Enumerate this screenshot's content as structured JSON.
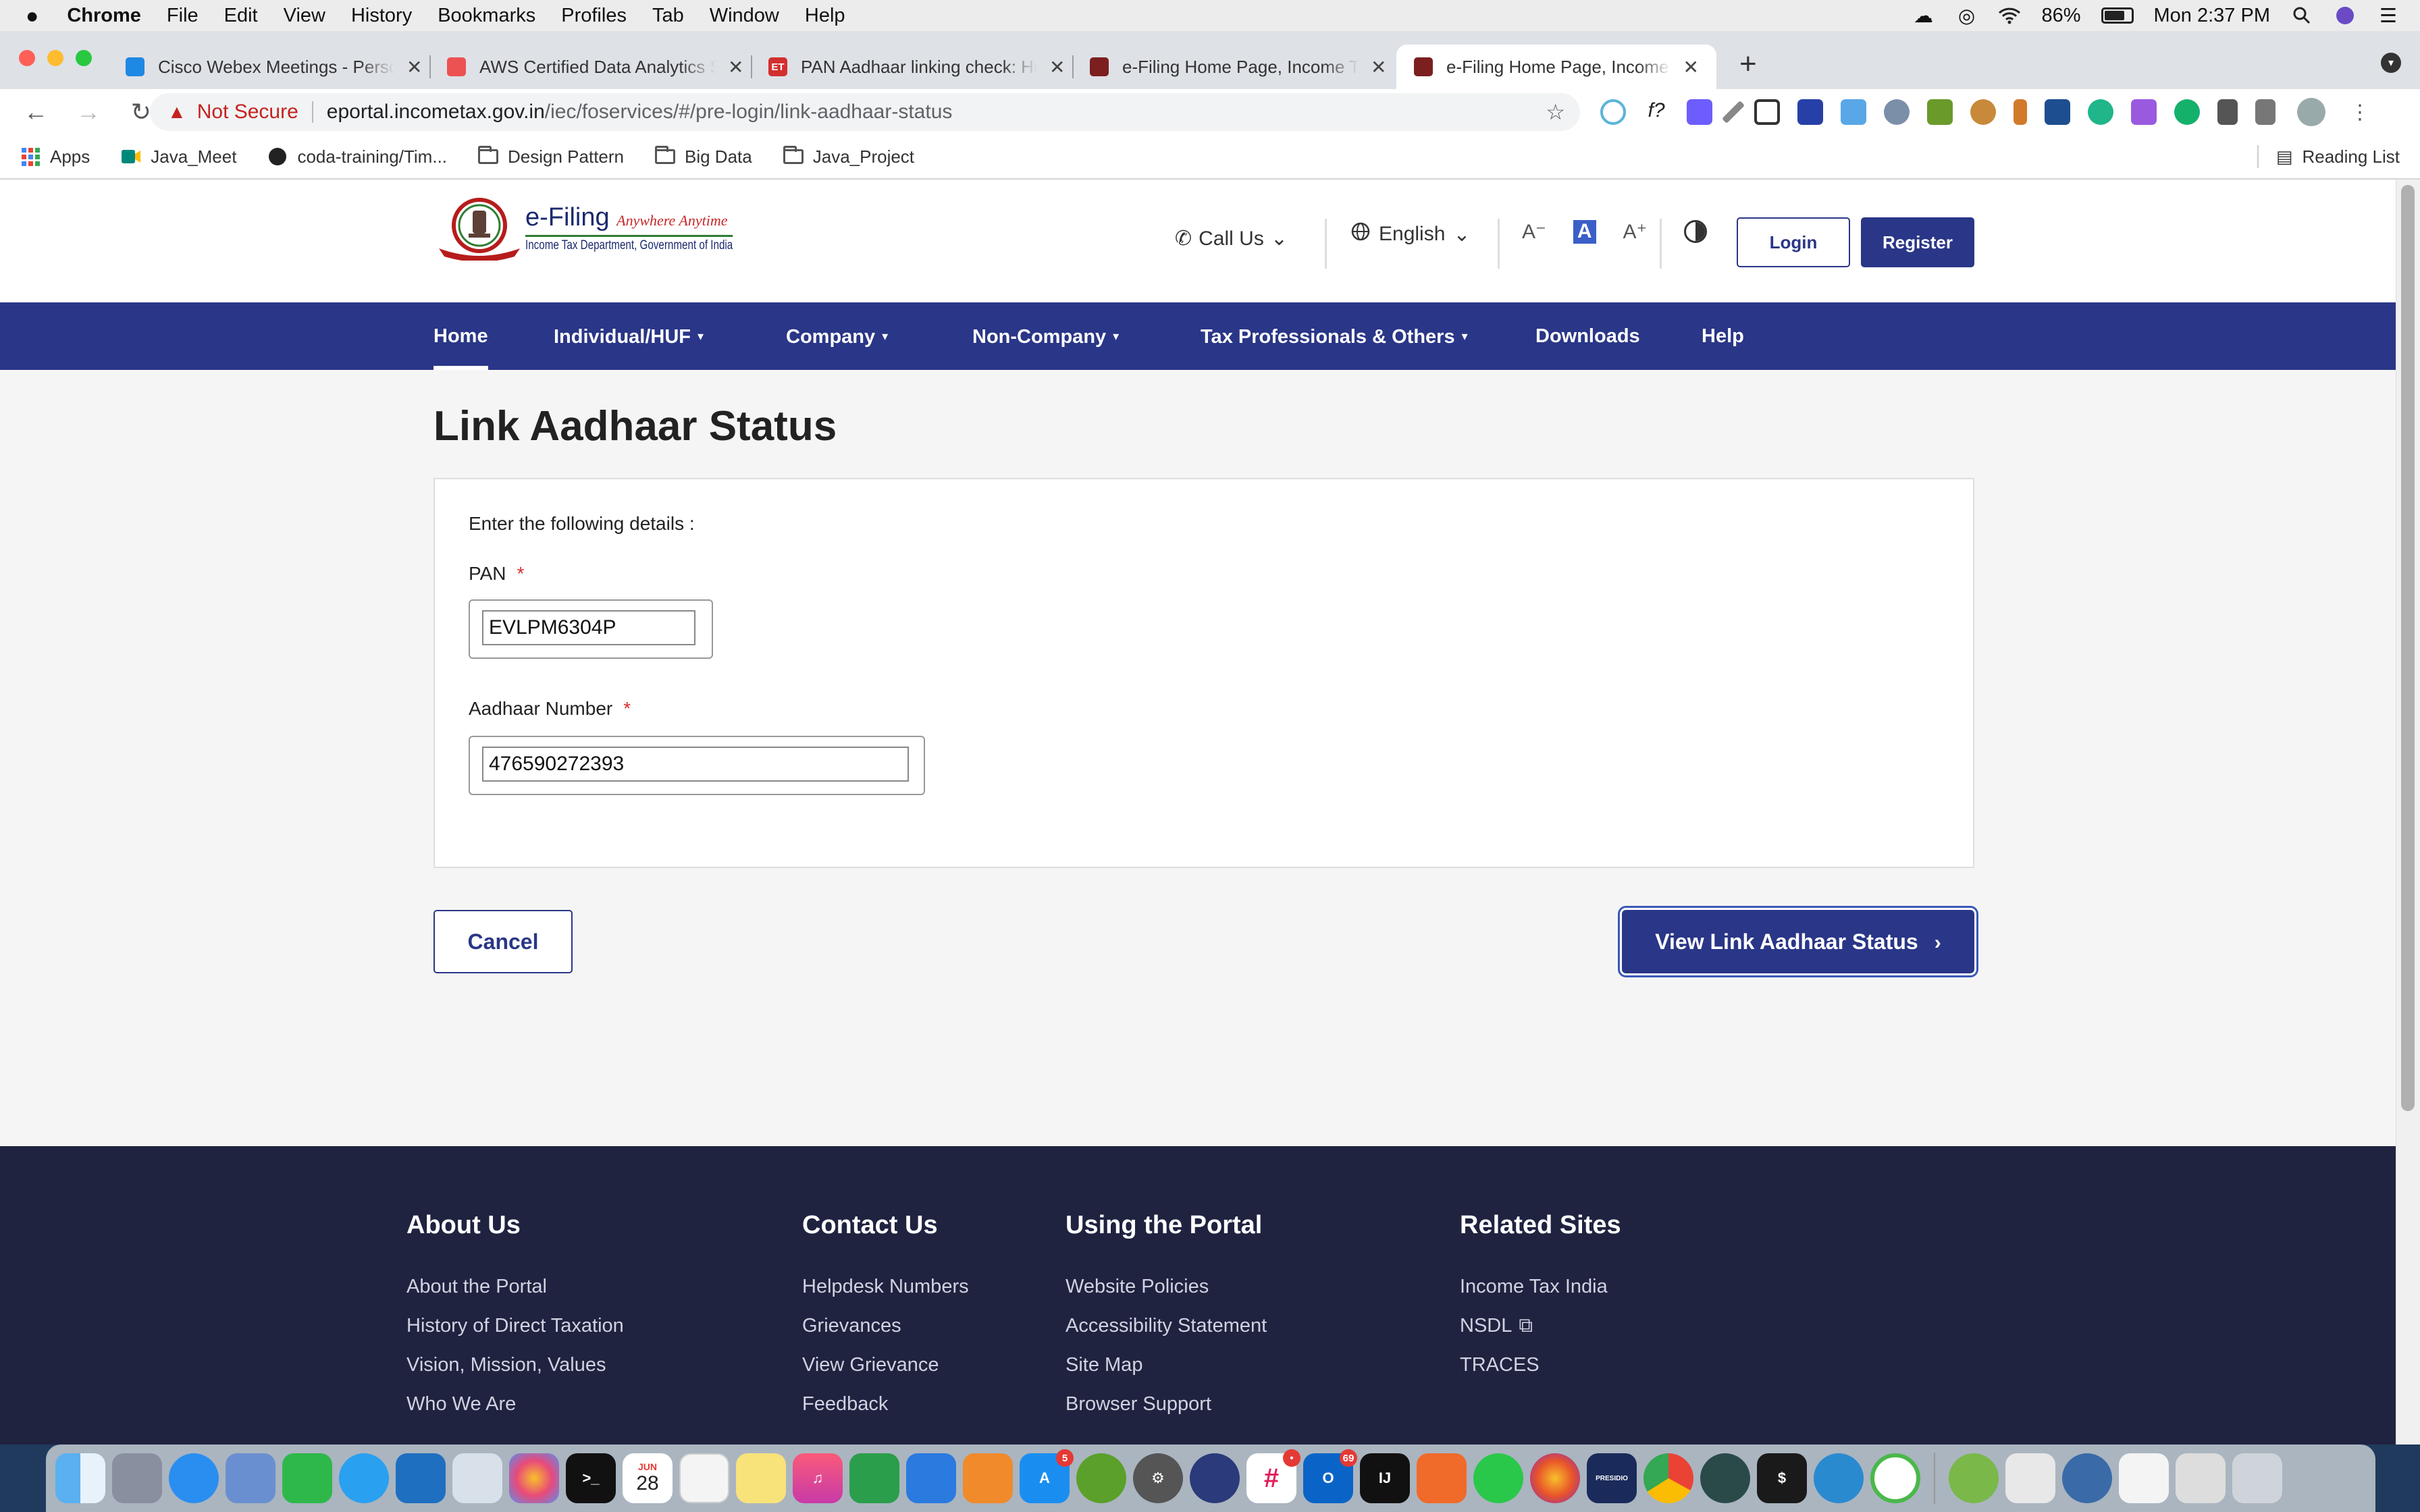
{
  "menubar": {
    "app": "Chrome",
    "items": [
      "File",
      "Edit",
      "View",
      "History",
      "Bookmarks",
      "Profiles",
      "Tab",
      "Window",
      "Help"
    ],
    "battery": "86%",
    "clock": "Mon 2:37 PM"
  },
  "tabs": [
    {
      "title": "Cisco Webex Meetings - Personal Room",
      "favicon_color": "#1e88e5"
    },
    {
      "title": "AWS Certified Data Analytics Specialty",
      "favicon_color": "#ec5252"
    },
    {
      "title": "PAN Aadhaar linking check: How to",
      "favicon_color": "#d32f2f"
    },
    {
      "title": "e-Filing Home Page, Income Tax Department",
      "favicon_color": "#7b1f1f"
    },
    {
      "title": "e-Filing Home Page, Income Tax Department",
      "favicon_color": "#7b1f1f"
    }
  ],
  "address": {
    "security": "Not Secure",
    "host": "eportal.incometax.gov.in",
    "path": "/iec/foservices/#/pre-login/link-aadhaar-status"
  },
  "bookmarks": {
    "items": [
      "Apps",
      "Java_Meet",
      "coda-training/Tim...",
      "Design Pattern",
      "Big Data",
      "Java_Project"
    ],
    "reading_list": "Reading List"
  },
  "site": {
    "logo": {
      "title": "e-Filing",
      "tagline": "Anywhere Anytime",
      "dept": "Income Tax Department, Government of India"
    },
    "call_us": "Call Us",
    "language": "English",
    "font_controls": [
      "A⁻",
      "A",
      "A⁺"
    ],
    "login": "Login",
    "register": "Register",
    "nav": [
      "Home",
      "Individual/HUF",
      "Company",
      "Non-Company",
      "Tax Professionals & Others",
      "Downloads",
      "Help"
    ]
  },
  "form": {
    "title": "Link Aadhaar Status",
    "instruction": "Enter the following details :",
    "pan_label": "PAN",
    "pan_value": "EVLPM6304P",
    "aadhaar_label": "Aadhaar Number",
    "aadhaar_value": "476590272393",
    "required_mark": "*",
    "cancel": "Cancel",
    "submit": "View Link Aadhaar Status"
  },
  "footer": {
    "columns": [
      {
        "heading": "About Us",
        "links": [
          "About the Portal",
          "History of Direct Taxation",
          "Vision, Mission, Values",
          "Who We Are"
        ]
      },
      {
        "heading": "Contact Us",
        "links": [
          "Helpdesk Numbers",
          "Grievances",
          "View Grievance",
          "Feedback"
        ]
      },
      {
        "heading": "Using the Portal",
        "links": [
          "Website Policies",
          "Accessibility Statement",
          "Site Map",
          "Browser Support"
        ]
      },
      {
        "heading": "Related Sites",
        "links": [
          "Income Tax India",
          "NSDL",
          "TRACES"
        ]
      }
    ]
  },
  "dock": {
    "badges": {
      "appstore": "5",
      "slack": "•",
      "outlook": "69"
    },
    "calendar_month": "JUN",
    "calendar_day": "28"
  },
  "colors": {
    "brand_navy": "#2a3687",
    "footer_bg": "#1f2340",
    "required_red": "#d32f2f"
  }
}
